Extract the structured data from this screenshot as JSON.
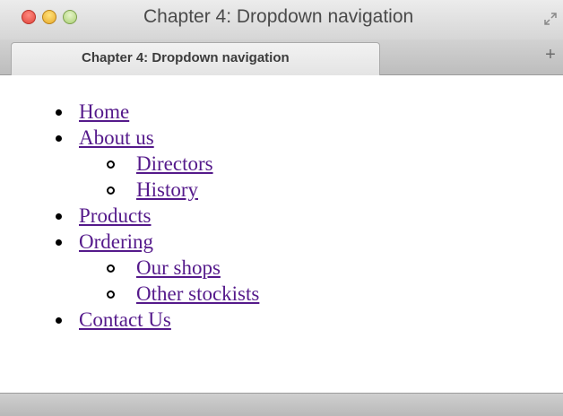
{
  "window": {
    "title": "Chapter 4: Dropdown navigation"
  },
  "tab": {
    "label": "Chapter 4: Dropdown navigation",
    "new_tab_symbol": "+"
  },
  "icons": {
    "fullscreen": "fullscreen-icon"
  },
  "nav": {
    "items": [
      {
        "label": "Home"
      },
      {
        "label": "About us",
        "children": [
          {
            "label": "Directors"
          },
          {
            "label": "History"
          }
        ]
      },
      {
        "label": "Products"
      },
      {
        "label": "Ordering",
        "children": [
          {
            "label": "Our shops"
          },
          {
            "label": "Other stockists"
          }
        ]
      },
      {
        "label": "Contact Us"
      }
    ]
  },
  "colors": {
    "link": "#551a8b",
    "close": "#e0443b",
    "minimize": "#e8a92b",
    "zoom": "#a9cf72"
  }
}
